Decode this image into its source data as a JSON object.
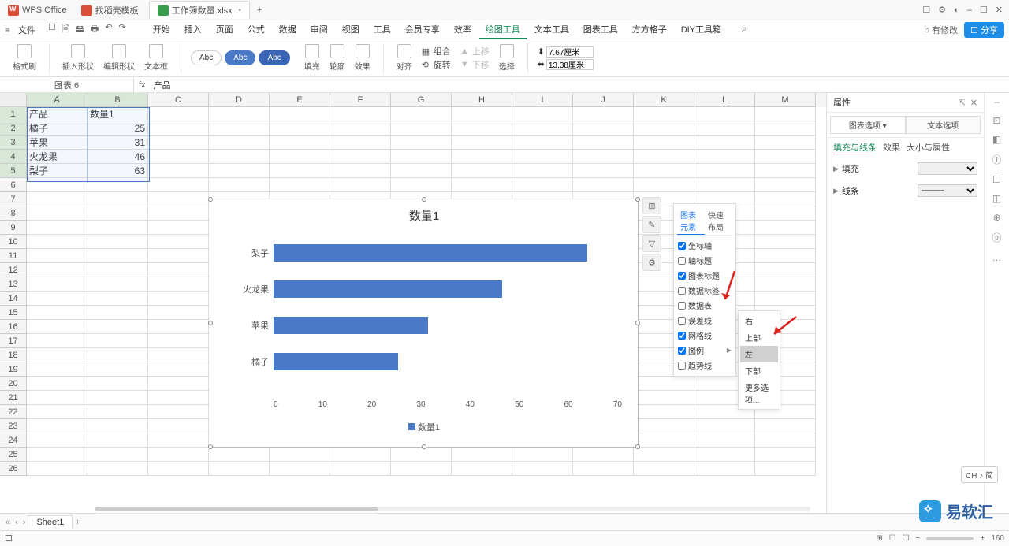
{
  "app": {
    "name": "WPS Office"
  },
  "tabs": [
    {
      "label": "找稻壳模板"
    },
    {
      "label": "工作簿数量.xlsx"
    }
  ],
  "tab_add": "+",
  "window_controls": {
    "braces": "☐",
    "globe": "⚙",
    "avatar": "◐",
    "min": "–",
    "max": "☐",
    "close": "✕"
  },
  "file_menu": "文件",
  "qat": {
    "new": "☐",
    "open": "🗎",
    "save": "🖴",
    "print": "🖶",
    "undo": "↶",
    "redo": "↷"
  },
  "ribbon_tabs": [
    "开始",
    "插入",
    "页面",
    "公式",
    "数据",
    "审阅",
    "视图",
    "工具",
    "会员专享",
    "效率",
    "绘图工具",
    "文本工具",
    "图表工具",
    "方方格子",
    "DIY工具箱"
  ],
  "ribbon_search_icon": "⌕",
  "menu_right": {
    "modify": "○ 有修改",
    "share": "☐ 分享"
  },
  "ribbon": {
    "format_painter": "格式刷",
    "insert_shape": "插入形状",
    "edit_shape": "编辑形状",
    "textbox": "文本框",
    "presets": [
      "Abc",
      "Abc",
      "Abc"
    ],
    "fill": "填充",
    "outline": "轮廓",
    "effects": "效果",
    "align": "对齐",
    "combine": "组合",
    "rotate": "旋转",
    "up": "上移",
    "down": "下移",
    "select": "选择",
    "height_value": "7.67厘米",
    "width_value": "13.38厘米"
  },
  "namebox": "图表 6",
  "fx_label": "fx",
  "formula": "产品",
  "columns": [
    "A",
    "B",
    "C",
    "D",
    "E",
    "F",
    "G",
    "H",
    "I",
    "J",
    "K",
    "L",
    "M"
  ],
  "row_numbers": [
    1,
    2,
    3,
    4,
    5,
    6,
    7,
    8,
    9,
    10,
    11,
    12,
    13,
    14,
    15,
    16,
    17,
    18,
    19,
    20,
    21,
    22,
    23,
    24,
    25,
    26
  ],
  "table": {
    "header": [
      "产品",
      "数量1"
    ],
    "rows": [
      [
        "橘子",
        25
      ],
      [
        "苹果",
        31
      ],
      [
        "火龙果",
        46
      ],
      [
        "梨子",
        63
      ]
    ]
  },
  "chart_data": {
    "type": "bar",
    "orientation": "horizontal",
    "title": "数量1",
    "categories": [
      "梨子",
      "火龙果",
      "苹果",
      "橘子"
    ],
    "values": [
      63,
      46,
      31,
      25
    ],
    "xlabel": "",
    "ylabel": "",
    "xlim": [
      0,
      70
    ],
    "x_ticks": [
      0,
      10,
      20,
      30,
      40,
      50,
      60,
      70
    ],
    "legend": [
      "数量1"
    ],
    "legend_position": "bottom",
    "series_color": "#4a7ac7"
  },
  "chart_tools": {
    "elements": "⊞",
    "style": "✎",
    "filter": "▽",
    "settings": "⚙"
  },
  "popup": {
    "tab_elements": "图表元素",
    "tab_layout": "快速布局",
    "items": [
      {
        "label": "坐标轴",
        "checked": true
      },
      {
        "label": "轴标题",
        "checked": false
      },
      {
        "label": "图表标题",
        "checked": true
      },
      {
        "label": "数据标签",
        "checked": false
      },
      {
        "label": "数据表",
        "checked": false
      },
      {
        "label": "误差线",
        "checked": false
      },
      {
        "label": "网格线",
        "checked": true
      },
      {
        "label": "图例",
        "checked": true,
        "arrow": true
      },
      {
        "label": "趋势线",
        "checked": false
      }
    ]
  },
  "submenu": {
    "items": [
      "右",
      "上部",
      "左",
      "下部",
      "更多选项..."
    ],
    "hovered_index": 2
  },
  "right_panel": {
    "title": "属性",
    "option_chart": "图表选项",
    "option_text": "文本选项",
    "subtab_fill": "填充与线条",
    "subtab_effect": "效果",
    "subtab_size": "大小与属性",
    "section_fill": "填充",
    "section_line": "线条"
  },
  "icon_rail": [
    "–",
    "⊡",
    "◧",
    "ⓘ",
    "☐",
    "◫",
    "⊕",
    "ⓞ",
    "…"
  ],
  "sheet_tabs": {
    "nav_first": "«",
    "nav_prev": "‹",
    "nav_next": "›",
    "tab1": "Sheet1",
    "add": "+"
  },
  "statusbar": {
    "left_icon": "☐",
    "grid": "⊞",
    "mode1": "☐",
    "mode2": "☐",
    "zoom_out": "−",
    "zoom_in": "+",
    "zoom": "160"
  },
  "ime": "CH ♪ 简",
  "watermark_text": "易软汇"
}
